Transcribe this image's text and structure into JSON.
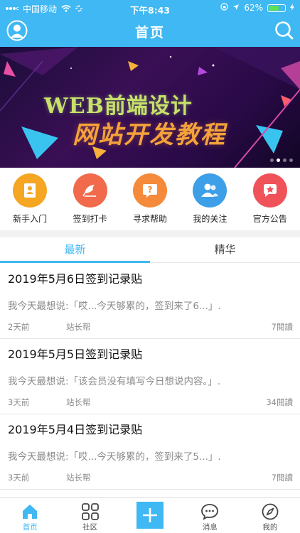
{
  "status_bar": {
    "carrier": "中国移动",
    "time": "下午8:43",
    "battery_percent": "62%",
    "battery_level": 0.62
  },
  "nav": {
    "title": "首页",
    "avatar_icon": "user-avatar-icon",
    "search_icon": "search-icon"
  },
  "banner": {
    "line1": "WEB前端设计",
    "line2": "网站开发教程",
    "slide_count": 4,
    "active_slide": 1
  },
  "quick_nav": [
    {
      "label": "新手入门",
      "icon": "book-icon",
      "color": "#f5a623"
    },
    {
      "label": "签到打卡",
      "icon": "pen-icon",
      "color": "#f06a4b"
    },
    {
      "label": "寻求帮助",
      "icon": "question-icon",
      "color": "#f58a3a"
    },
    {
      "label": "我的关注",
      "icon": "people-icon",
      "color": "#3d9fe8"
    },
    {
      "label": "官方公告",
      "icon": "star-icon",
      "color": "#f0525a"
    }
  ],
  "tabs": [
    {
      "label": "最新",
      "active": true
    },
    {
      "label": "精华",
      "active": false
    }
  ],
  "posts": [
    {
      "title": "2019年5月6日签到记录贴",
      "excerpt": "我今天最想说:「哎...今天够累的，签到来了6...」.",
      "time": "2天前",
      "author": "站长帮",
      "views": "7閱讀"
    },
    {
      "title": "2019年5月5日签到记录贴",
      "excerpt": "我今天最想说:「该会员没有填写今日想说内容。」.",
      "time": "3天前",
      "author": "站长帮",
      "views": "34閱讀"
    },
    {
      "title": "2019年5月4日签到记录贴",
      "excerpt": "我今天最想说:「哎...今天够累的，签到来了5...」.",
      "time": "3天前",
      "author": "站长帮",
      "views": "7閱讀"
    }
  ],
  "tabbar": [
    {
      "label": "首页",
      "icon": "home-icon",
      "active": true
    },
    {
      "label": "社区",
      "icon": "grid-icon",
      "active": false
    },
    {
      "label": "",
      "icon": "plus-icon",
      "active": false
    },
    {
      "label": "消息",
      "icon": "chat-icon",
      "active": false
    },
    {
      "label": "我的",
      "icon": "compass-icon",
      "active": false
    }
  ],
  "colors": {
    "brand": "#3fb8f3",
    "banner_bg": "#2a0a48"
  }
}
